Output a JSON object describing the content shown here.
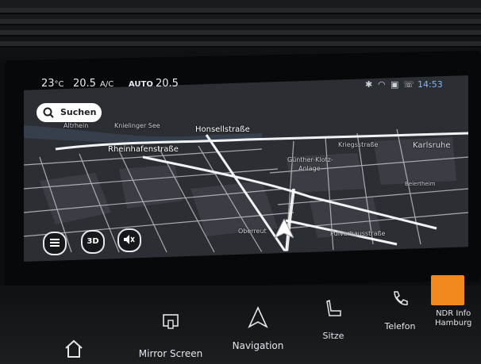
{
  "status_bar": {
    "temp_outside": "23",
    "temp_unit": "°C",
    "driver_temp": "20.5",
    "ac_label": "A/C",
    "auto_label": "AUTO",
    "passenger_temp": "20.5",
    "time": "14:53",
    "icons": [
      "bluetooth-icon",
      "wifi-icon",
      "car-icon",
      "phone-connect-icon"
    ]
  },
  "search": {
    "label": "Suchen",
    "icon": "search-icon"
  },
  "map": {
    "street_labels": {
      "altrhein": "Altrhein",
      "knielinger_see": "Knielinger See",
      "honsellstrasse": "Honsellstraße",
      "rheinhafenstrasse": "Rheinhafenstraße",
      "kriegsstrasse": "Kriegsstraße",
      "karlsruhe": "Karlsruhe",
      "guenther_klotz": "Günther-Klotz-",
      "anlage": "Anlage",
      "beiertheim": "Beiertheim",
      "oberreut": "Oberreut",
      "pulverhausstrasse": "Pulverhausstraße"
    }
  },
  "map_controls": {
    "menu_icon": "menu-icon",
    "view_3d_label": "3D",
    "mute_icon": "speaker-muted-icon"
  },
  "bottom_bar": {
    "home_icon": "home-icon",
    "mirror_screen_label": "Mirror Screen",
    "navigation_label": "Navigation",
    "sitze_label": "Sitze",
    "telefon_label": "Telefon",
    "radio_label_1": "NDR Info",
    "radio_label_2": "Hamburg"
  },
  "colors": {
    "map_background": "#2b2e33",
    "road": "#e9ebef",
    "accent_time": "#7fb7ff",
    "radio_tile": "#f08a1c"
  }
}
